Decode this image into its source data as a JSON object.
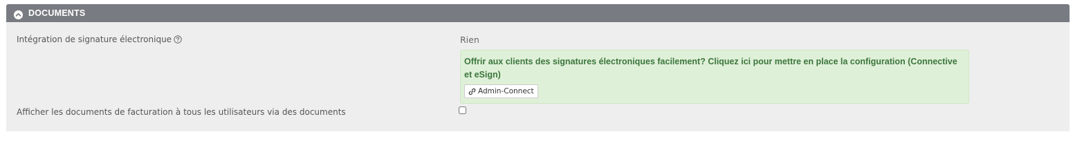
{
  "section": {
    "title": "DOCUMENTS",
    "collapse_icon": "chevron-up-circle-icon"
  },
  "rows": [
    {
      "label": "Intégration de signature électronique",
      "help_icon": "question-circle-icon",
      "value": "Rien",
      "promo": {
        "text": "Offrir aux clients des signatures électroniques facilement? Cliquez ici pour mettre en place la configuration (Connective et eSign)",
        "button_label": "Admin-Connect",
        "button_icon": "link-icon"
      }
    },
    {
      "label": "Afficher les documents de facturation à tous les utilisateurs via des documents",
      "checkbox_checked": false
    }
  ],
  "colors": {
    "header_bg": "#787c82",
    "panel_bg": "#eeeeee",
    "promo_bg": "#dff0d8",
    "promo_text": "#3c763d"
  }
}
